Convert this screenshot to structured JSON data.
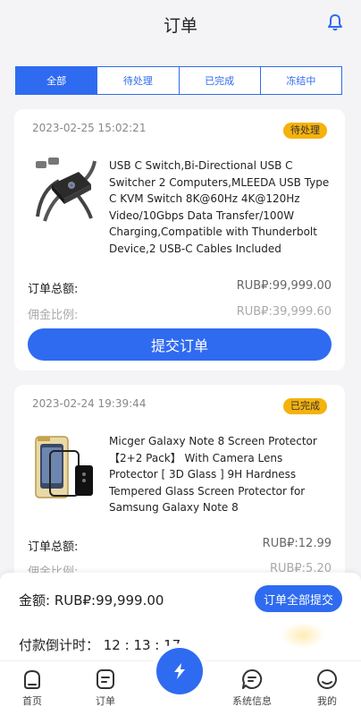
{
  "header": {
    "title": "订单"
  },
  "tabs": [
    {
      "label": "全部"
    },
    {
      "label": "待处理"
    },
    {
      "label": "已完成"
    },
    {
      "label": "冻结中"
    }
  ],
  "orders": [
    {
      "time": "2023-02-25 15:02:21",
      "status": "待处理",
      "description": "USB C Switch,Bi-Directional USB C Switcher 2 Computers,MLEEDA USB Type C KVM Switch 8K@60Hz 4K@120Hz Video/10Gbps Data Transfer/100W Charging,Compatible with Thunderbolt Device,2 USB-C Cables Included",
      "total_label": "订单总额:",
      "total_value": "RUB₽:99,999.00",
      "commission_label": "佣金比例:",
      "commission_value": "RUB₽:39,999.60",
      "submit_label": "提交订单",
      "thumb_icon": "usb-switch-product-image"
    },
    {
      "time": "2023-02-24 19:39:44",
      "status": "已完成",
      "description": "Micger Galaxy Note 8 Screen Protector 【2+2 Pack】 With Camera Lens Protector [ 3D Glass ] 9H Hardness Tempered Glass Screen Protector for Samsung Galaxy Note 8",
      "total_label": "订单总额:",
      "total_value": "RUB₽:12.99",
      "commission_label": "佣金比例:",
      "commission_value": "RUB₽:5.20",
      "thumb_icon": "screen-protector-product-image"
    }
  ],
  "summary": {
    "amount_text": "金额:  RUB₽:99,999.00",
    "submit_all_label": "订单全部提交",
    "countdown_text": "付款倒计时：  12 : 13 : 17"
  },
  "tabbar": {
    "items": [
      {
        "label": "首页",
        "icon": "home-icon"
      },
      {
        "label": "订单",
        "icon": "order-icon"
      },
      {
        "label": "系统信息",
        "icon": "message-icon"
      },
      {
        "label": "我的",
        "icon": "profile-icon"
      }
    ],
    "center_icon": "lightning-icon"
  },
  "colors": {
    "accent": "#2f6bf0",
    "badge": "#f5b20c",
    "background": "#f4f4f6"
  }
}
